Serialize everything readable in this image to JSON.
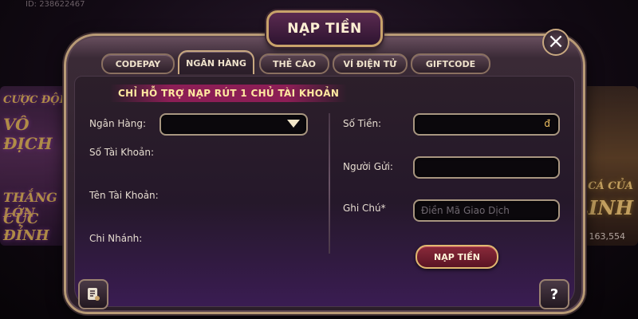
{
  "background": {
    "id_text": "ID: 238622467",
    "left_banner_lines": [
      "CƯỢC ĐỘI",
      "VÔ ĐỊCH",
      "THẮNG LỚN",
      "CỰC ĐỈNH"
    ],
    "right_banner_lines": [
      "CÁ CỦA",
      "LINH"
    ],
    "coins_text": "163,554"
  },
  "dialog": {
    "title": "NẠP TIỀN",
    "close_label": "×",
    "tabs": [
      {
        "label": "CODEPAY",
        "active": false
      },
      {
        "label": "NGÂN HÀNG",
        "active": true
      },
      {
        "label": "THẺ CÀO",
        "active": false
      },
      {
        "label": "VÍ ĐIỆN TỬ",
        "active": false
      },
      {
        "label": "GIFTCODE",
        "active": false
      }
    ],
    "notice": "CHỈ HỖ TRỢ NẠP RÚT 1 CHỦ TÀI KHOẢN",
    "left_form": {
      "bank_label": "Ngân Hàng:",
      "bank_value": "",
      "account_number_label": "Số Tài Khoản:",
      "account_name_label": "Tên Tài Khoản:",
      "branch_label": "Chi Nhánh:"
    },
    "right_form": {
      "amount_label": "Số Tiền:",
      "amount_value": "",
      "currency_symbol": "đ",
      "sender_label": "Người Gửi:",
      "sender_value": "",
      "note_label": "Ghi Chú*",
      "note_placeholder": "Điền Mã Giao Dịch"
    },
    "submit_label": "NẠP TIỀN",
    "help_label": "?"
  }
}
